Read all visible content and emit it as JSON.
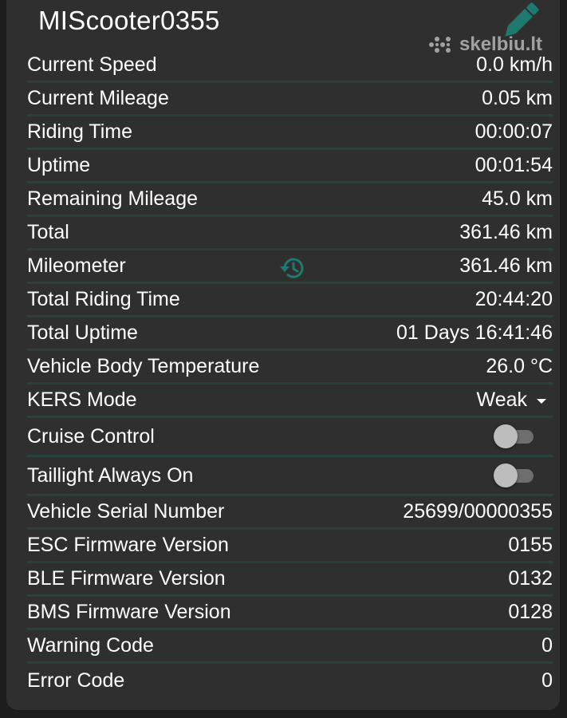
{
  "header": {
    "title": "MIScooter0355",
    "edit_icon": "pencil-icon",
    "watermark": "skelbiu.lt"
  },
  "colors": {
    "accent": "#1e7a6e",
    "divider": "#27423e",
    "card": "#2f2f2f",
    "background": "#1d1d1d"
  },
  "rows": [
    {
      "label": "Current Speed",
      "value": "0.0 km/h"
    },
    {
      "label": "Current Mileage",
      "value": "0.05 km"
    },
    {
      "label": "Riding Time",
      "value": "00:00:07"
    },
    {
      "label": "Uptime",
      "value": "00:01:54"
    },
    {
      "label": "Remaining Mileage",
      "value": "45.0 km"
    },
    {
      "label": "Total",
      "value": "361.46 km"
    },
    {
      "label": "Mileometer",
      "value": "361.46 km",
      "icon": "history-icon"
    },
    {
      "label": "Total Riding Time",
      "value": "20:44:20"
    },
    {
      "label": "Total Uptime",
      "value": "01 Days 16:41:46"
    },
    {
      "label": "Vehicle Body Temperature",
      "value": "26.0 °C"
    },
    {
      "label": "KERS Mode",
      "value": "Weak"
    },
    {
      "label": "Cruise Control",
      "enabled": false
    },
    {
      "label": "Taillight Always On",
      "enabled": false
    },
    {
      "label": "Vehicle Serial Number",
      "value": "25699/00000355"
    },
    {
      "label": "ESC Firmware Version",
      "value": "0155"
    },
    {
      "label": "BLE Firmware Version",
      "value": "0132"
    },
    {
      "label": "BMS Firmware Version",
      "value": "0128"
    },
    {
      "label": "Warning Code",
      "value": "0"
    },
    {
      "label": "Error Code",
      "value": "0"
    }
  ]
}
